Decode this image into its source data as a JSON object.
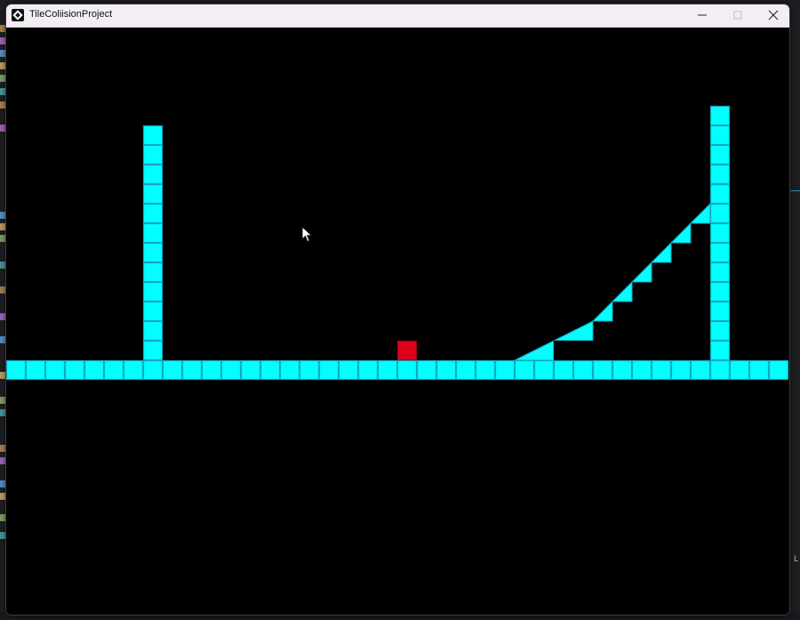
{
  "window": {
    "title": "TileColiisionProject"
  },
  "icons": {
    "app": "game-engine-logo-icon",
    "minimize": "minimize-icon",
    "maximize": "maximize-icon",
    "close": "close-icon",
    "cursor": "mouse-pointer-icon"
  },
  "colors": {
    "tile_fill": "#00ffff",
    "tile_border": "#11a7bd",
    "player": "#e0001b",
    "background": "#000000",
    "titlebar": "#f3eef3"
  },
  "background_app": {
    "right_label": "L"
  },
  "scene": {
    "tile_size_units": 1,
    "floor": {
      "row": 0,
      "from_col": 0,
      "to_col": 39
    },
    "left_pillar": {
      "col": 7,
      "height_tiles": 12
    },
    "right_pillar": {
      "col": 36,
      "height_tiles": 13
    },
    "player": {
      "col": 20,
      "row": 1
    },
    "slope_segments": [
      {
        "type": "ramp",
        "from_col": 26,
        "to_col": 28,
        "rise": 1
      },
      {
        "type": "ramp",
        "from_col": 28,
        "to_col": 30,
        "rise": 1
      },
      {
        "type": "steps",
        "from_col": 30,
        "to_col": 36,
        "rise_per_col": 1
      }
    ]
  }
}
